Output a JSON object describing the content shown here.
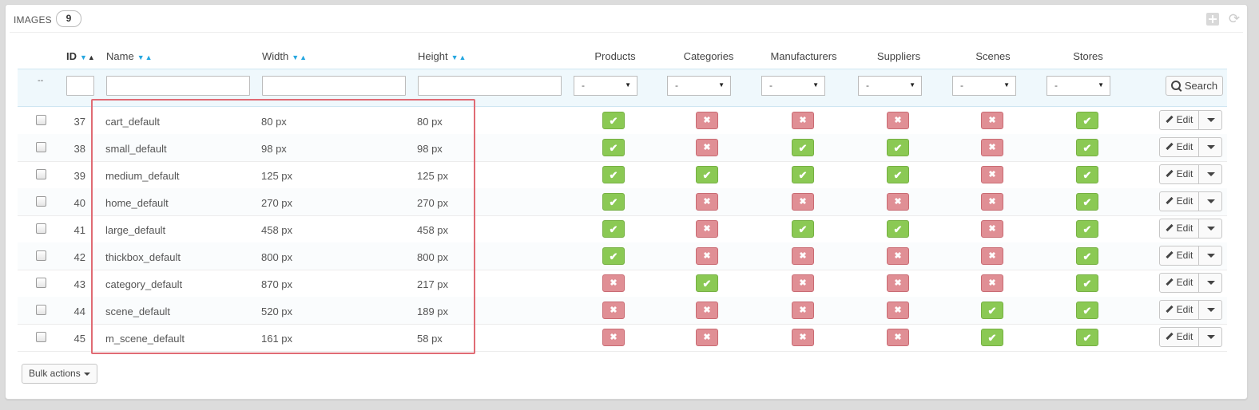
{
  "panel": {
    "title": "IMAGES",
    "count": "9"
  },
  "columns": {
    "id": "ID",
    "name": "Name",
    "width": "Width",
    "height": "Height",
    "products": "Products",
    "categories": "Categories",
    "manufacturers": "Manufacturers",
    "suppliers": "Suppliers",
    "scenes": "Scenes",
    "stores": "Stores"
  },
  "filters": {
    "dash": "--",
    "select_value": "-",
    "search_label": "Search"
  },
  "rows": [
    {
      "id": "37",
      "name": "cart_default",
      "width": "80 px",
      "height": "80 px",
      "products": true,
      "categories": false,
      "manufacturers": false,
      "suppliers": false,
      "scenes": false,
      "stores": true
    },
    {
      "id": "38",
      "name": "small_default",
      "width": "98 px",
      "height": "98 px",
      "products": true,
      "categories": false,
      "manufacturers": true,
      "suppliers": true,
      "scenes": false,
      "stores": true
    },
    {
      "id": "39",
      "name": "medium_default",
      "width": "125 px",
      "height": "125 px",
      "products": true,
      "categories": true,
      "manufacturers": true,
      "suppliers": true,
      "scenes": false,
      "stores": true
    },
    {
      "id": "40",
      "name": "home_default",
      "width": "270 px",
      "height": "270 px",
      "products": true,
      "categories": false,
      "manufacturers": false,
      "suppliers": false,
      "scenes": false,
      "stores": true
    },
    {
      "id": "41",
      "name": "large_default",
      "width": "458 px",
      "height": "458 px",
      "products": true,
      "categories": false,
      "manufacturers": true,
      "suppliers": true,
      "scenes": false,
      "stores": true
    },
    {
      "id": "42",
      "name": "thickbox_default",
      "width": "800 px",
      "height": "800 px",
      "products": true,
      "categories": false,
      "manufacturers": false,
      "suppliers": false,
      "scenes": false,
      "stores": true
    },
    {
      "id": "43",
      "name": "category_default",
      "width": "870 px",
      "height": "217 px",
      "products": false,
      "categories": true,
      "manufacturers": false,
      "suppliers": false,
      "scenes": false,
      "stores": true
    },
    {
      "id": "44",
      "name": "scene_default",
      "width": "520 px",
      "height": "189 px",
      "products": false,
      "categories": false,
      "manufacturers": false,
      "suppliers": false,
      "scenes": true,
      "stores": true
    },
    {
      "id": "45",
      "name": "m_scene_default",
      "width": "161 px",
      "height": "58 px",
      "products": false,
      "categories": false,
      "manufacturers": false,
      "suppliers": false,
      "scenes": true,
      "stores": true
    }
  ],
  "row_actions": {
    "edit_label": "Edit"
  },
  "footer": {
    "bulk_label": "Bulk actions"
  },
  "colors": {
    "yes": "#8bc954",
    "no": "#e08f95",
    "highlight": "#e06b74",
    "sort_arrow": "#26a7e0"
  },
  "icons": {
    "yes": "check-icon",
    "no": "cross-icon"
  }
}
